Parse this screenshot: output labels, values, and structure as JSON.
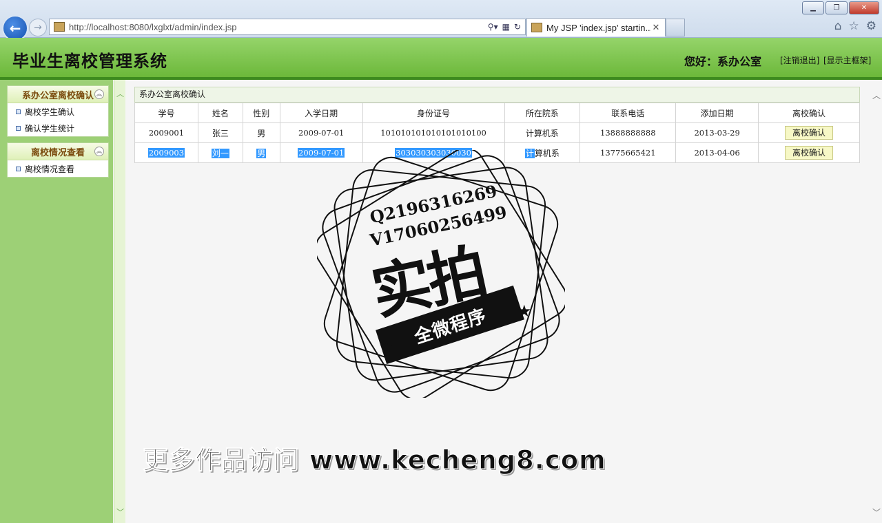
{
  "browser": {
    "url": "http://localhost:8080/lxglxt/admin/index.jsp",
    "tab_title": "My JSP 'index.jsp' startin..."
  },
  "header": {
    "title": "毕业生离校管理系统",
    "greeting": "您好：系办公室",
    "logout": "[注销退出]",
    "show_frame": "[显示主框架]"
  },
  "sidebar": {
    "groups": [
      {
        "title": "系办公室离校确认",
        "items": [
          "离校学生确认",
          "确认学生统计"
        ]
      },
      {
        "title": "离校情况查看",
        "items": [
          "离校情况查看"
        ]
      }
    ]
  },
  "panel": {
    "title": "系办公室离校确认",
    "columns": [
      "学号",
      "姓名",
      "性别",
      "入学日期",
      "身份证号",
      "所在院系",
      "联系电话",
      "添加日期",
      "离校确认"
    ],
    "rows": [
      [
        "2009001",
        "张三",
        "男",
        "2009-07-01",
        "101010101010101010100",
        "计算机系",
        "13888888888",
        "2013-03-29",
        "离校确认"
      ],
      [
        "2009003",
        "刘一",
        "男",
        "2009-07-01",
        "303030303030030",
        "计算机系",
        "13775665421",
        "2013-04-06",
        "离校确认"
      ]
    ],
    "row1_dept_split": [
      "计",
      "算机系"
    ]
  },
  "watermark": {
    "line1": "Q2196316269",
    "line2": "V17060256499",
    "big": "实拍",
    "banner": "全微程序",
    "bottom": "更多作品访问 www.kecheng8.com"
  },
  "colors": {
    "header_green": "#6cb83a",
    "sidebar_green": "#9dd076",
    "selection_blue": "#3399ff"
  }
}
